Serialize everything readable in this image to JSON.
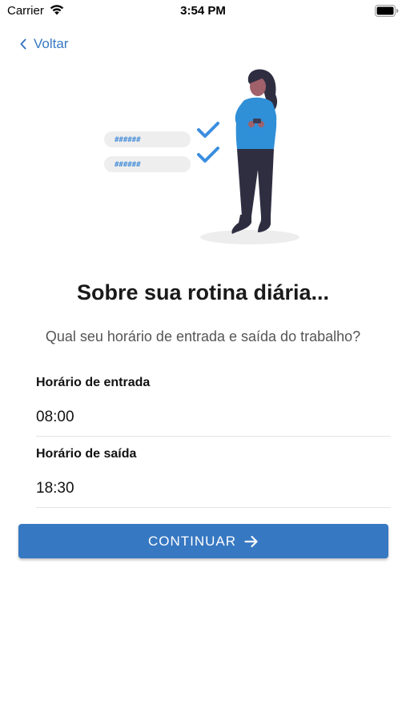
{
  "status_bar": {
    "carrier": "Carrier",
    "time": "3:54 PM",
    "icons": [
      "wifi-icon",
      "battery-icon"
    ]
  },
  "nav": {
    "back_label": "Voltar",
    "back_icon": "chevron-left-icon"
  },
  "illustration": {
    "password_mask_1": "######",
    "password_mask_2": "######",
    "icons": [
      "checkmark-icon",
      "checkmark-icon",
      "person-with-phone"
    ]
  },
  "header": {
    "title": "Sobre sua rotina diária...",
    "subtitle": "Qual seu horário de entrada e saída do trabalho?"
  },
  "form": {
    "entrada": {
      "label": "Horário de entrada",
      "value": "08:00"
    },
    "saida": {
      "label": "Horário de saída",
      "value": "18:30"
    }
  },
  "actions": {
    "continue_label": "CONTINUAR",
    "continue_icon": "arrow-right-icon"
  },
  "colors": {
    "accent": "#3778c2",
    "text": "#1a1a1a",
    "muted": "#555555",
    "divider": "#e4e4e4"
  }
}
